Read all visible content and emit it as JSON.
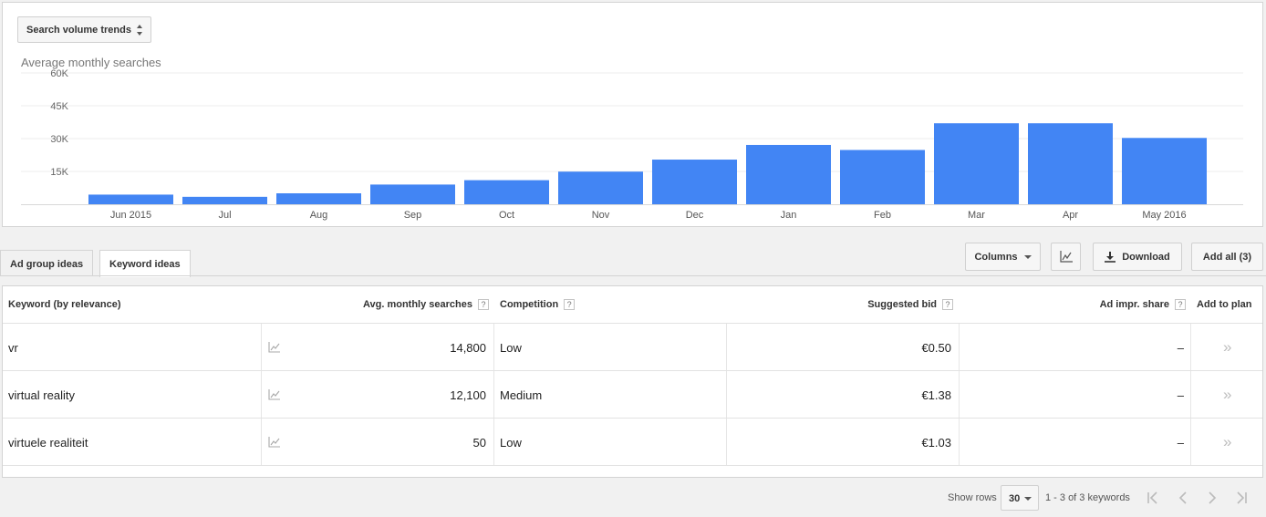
{
  "chart_panel": {
    "trend_select_label": "Search volume trends",
    "title": "Average monthly searches"
  },
  "chart_data": {
    "type": "bar",
    "title": "Average monthly searches",
    "categories": [
      "Jun 2015",
      "Jul",
      "Aug",
      "Sep",
      "Oct",
      "Nov",
      "Dec",
      "Jan",
      "Feb",
      "Mar",
      "Apr",
      "May 2016"
    ],
    "values": [
      4400,
      3400,
      5000,
      9000,
      11000,
      14900,
      20400,
      27100,
      24800,
      37000,
      37000,
      30300
    ],
    "yticks": [
      15000,
      30000,
      45000,
      60000
    ],
    "ytick_labels": [
      "15K",
      "30K",
      "45K",
      "60K"
    ],
    "ylim": [
      0,
      60000
    ],
    "grid": true,
    "bar_color": "#4285f4"
  },
  "tabs": [
    {
      "label": "Ad group ideas",
      "active": false
    },
    {
      "label": "Keyword ideas",
      "active": true
    }
  ],
  "toolbar": {
    "columns_label": "Columns",
    "download_label": "Download",
    "add_all_label": "Add all (3)"
  },
  "table": {
    "headers": {
      "keyword": "Keyword (by relevance)",
      "avg_searches": "Avg. monthly searches",
      "competition": "Competition",
      "suggested_bid": "Suggested bid",
      "ad_impr_share": "Ad impr. share",
      "add_to_plan": "Add to plan"
    },
    "help_glyph": "?",
    "add_glyph": "»",
    "rows": [
      {
        "keyword": "vr",
        "avg_searches": "14,800",
        "competition": "Low",
        "suggested_bid": "€0.50",
        "ad_impr_share": "–"
      },
      {
        "keyword": "virtual reality",
        "avg_searches": "12,100",
        "competition": "Medium",
        "suggested_bid": "€1.38",
        "ad_impr_share": "–"
      },
      {
        "keyword": "virtuele realiteit",
        "avg_searches": "50",
        "competition": "Low",
        "suggested_bid": "€1.03",
        "ad_impr_share": "–"
      }
    ]
  },
  "footer": {
    "show_rows_label": "Show rows",
    "rows_value": "30",
    "range_text": "1 - 3 of 3 keywords"
  }
}
